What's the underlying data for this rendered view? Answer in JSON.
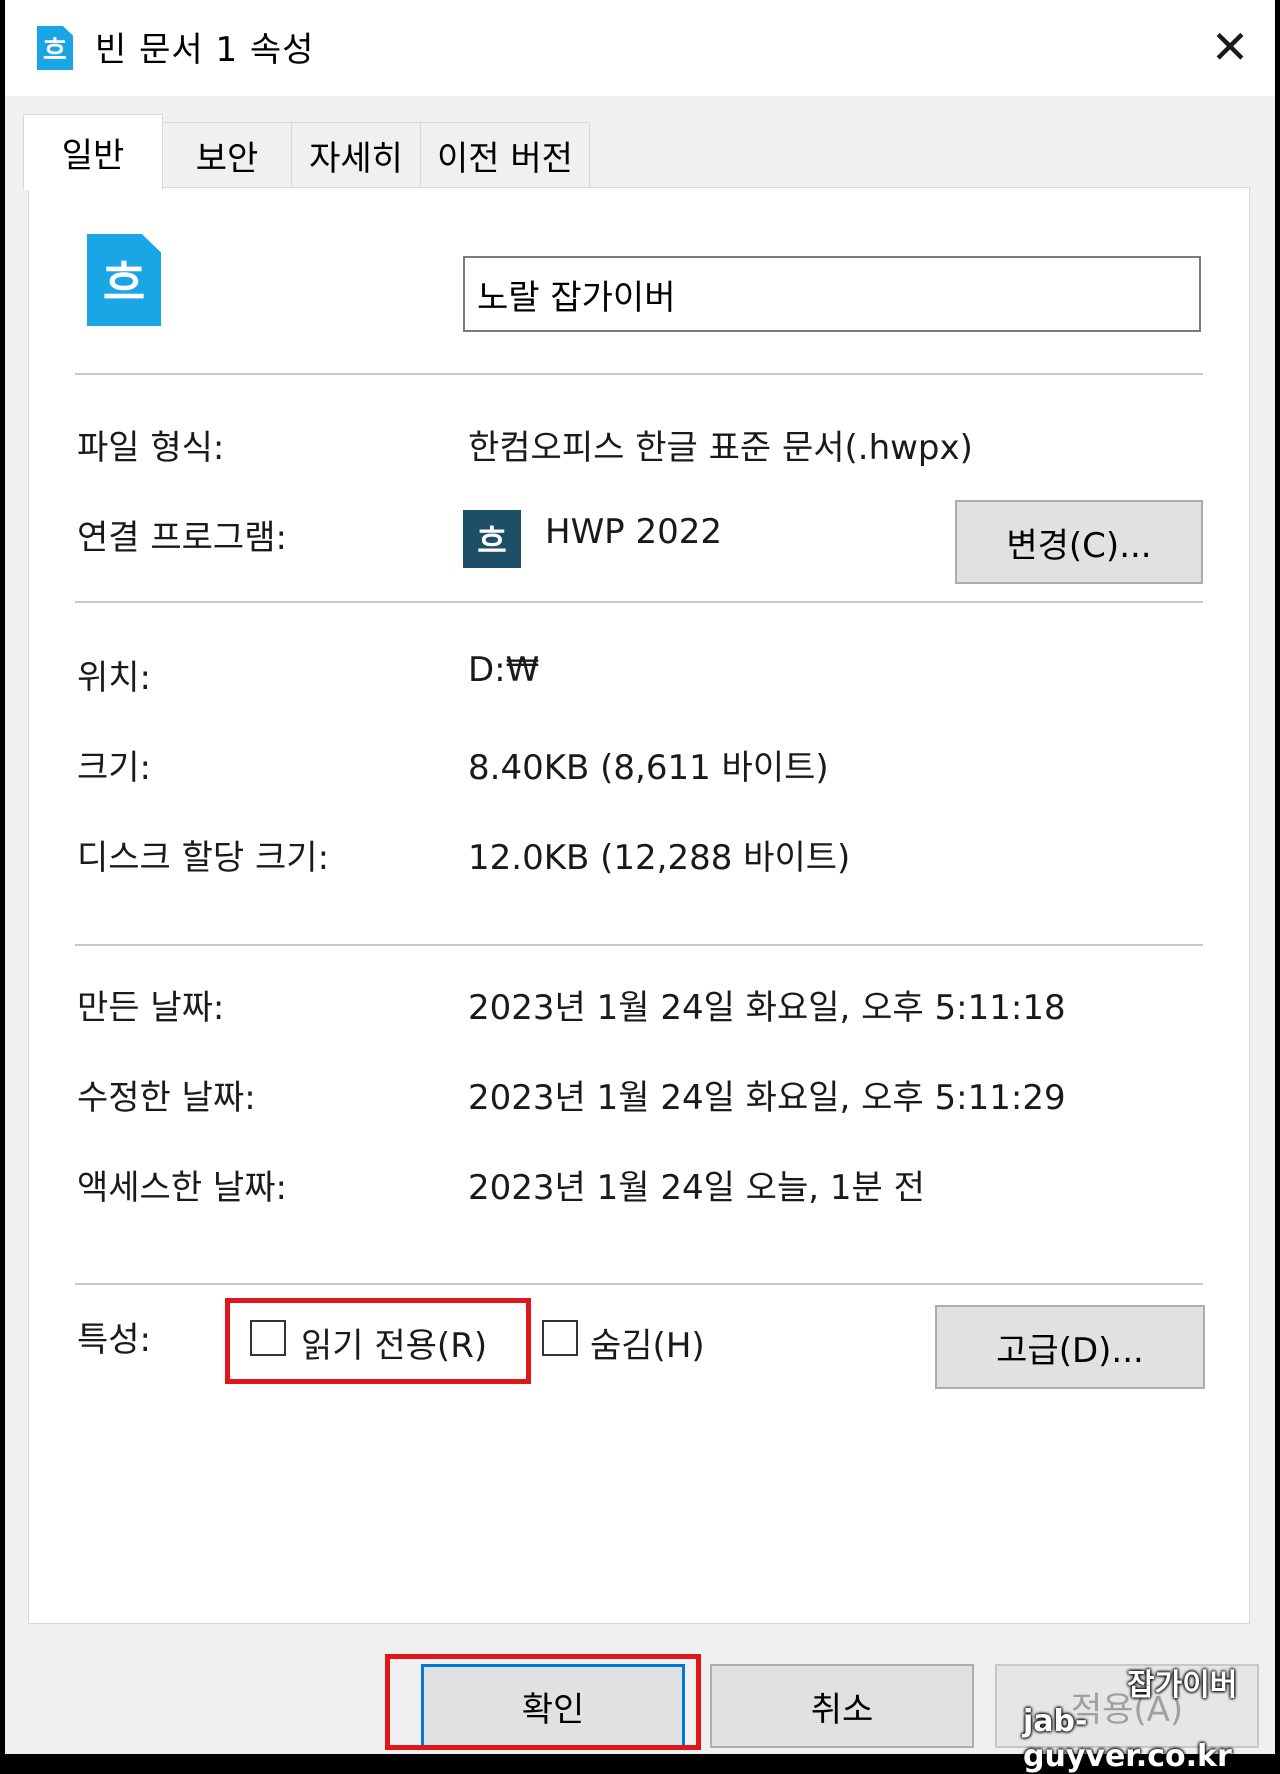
{
  "window": {
    "title": "빈 문서 1 속성",
    "title_icon_glyph": "흐",
    "close_glyph": "✕"
  },
  "tabs": [
    {
      "label": "일반",
      "active": true
    },
    {
      "label": "보안",
      "active": false
    },
    {
      "label": "자세히",
      "active": false
    },
    {
      "label": "이전 버전",
      "active": false
    }
  ],
  "general": {
    "file_icon_glyph": "흐",
    "file_name": "노랄 잡가이버",
    "file_type_label": "파일 형식:",
    "file_type_value": "한컴오피스 한글 표준 문서(.hwpx)",
    "opens_with_label": "연결 프로그램:",
    "opens_with_icon_glyph": "흐",
    "opens_with_value": "HWP 2022",
    "change_button": "변경(C)...",
    "location_label": "위치:",
    "location_value": "D:₩",
    "size_label": "크기:",
    "size_value": "8.40KB (8,611 바이트)",
    "size_on_disk_label": "디스크 할당 크기:",
    "size_on_disk_value": "12.0KB (12,288 바이트)",
    "created_label": "만든 날짜:",
    "created_value": "2023년 1월 24일 화요일, 오후 5:11:18",
    "modified_label": "수정한 날짜:",
    "modified_value": "2023년 1월 24일 화요일, 오후 5:11:29",
    "accessed_label": "액세스한 날짜:",
    "accessed_value": "2023년 1월 24일 오늘, 1분 전",
    "attributes_label": "특성:",
    "readonly_label": "읽기 전용(R)",
    "readonly_checked": false,
    "hidden_label": "숨김(H)",
    "hidden_checked": false,
    "advanced_button": "고급(D)..."
  },
  "footer": {
    "ok_button": "확인",
    "cancel_button": "취소",
    "apply_button": "적용(A)"
  },
  "watermark": {
    "line1": "잡가이버",
    "line2": "jab-guyver.co.kr"
  },
  "colors": {
    "highlight": "#e0161b",
    "hwp_icon": "#1aa6e6",
    "hwp_program_icon": "#1d4f66",
    "ok_focus": "#0078d7"
  }
}
